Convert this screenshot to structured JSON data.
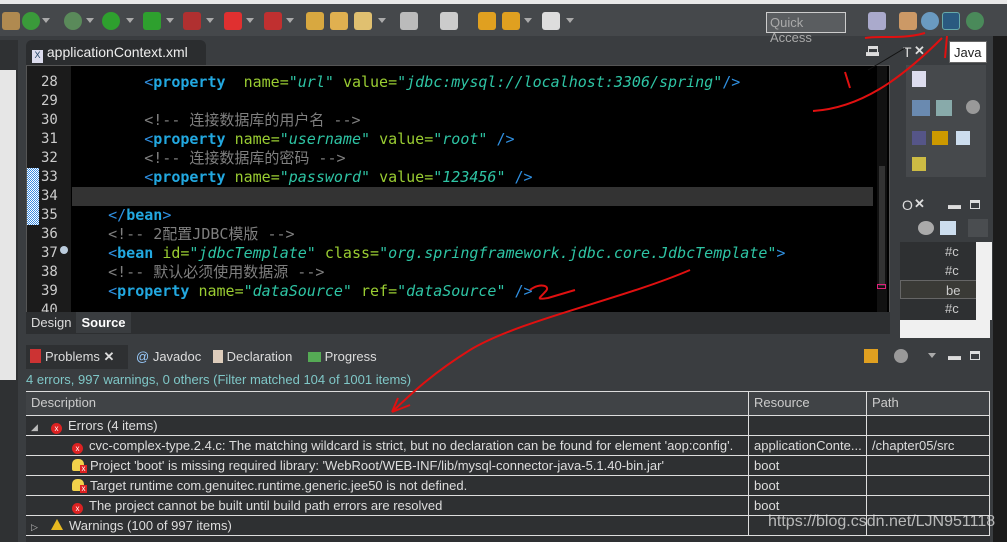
{
  "toolbar": {
    "quick_access": "Quick Access",
    "icons": [
      "new-server-icon",
      "new-class-icon",
      "debug-icon",
      "run-icon",
      "run-server-icon",
      "run-external-icon",
      "stop-icon",
      "disconnect-icon",
      "open-folder-icon",
      "open-type-icon",
      "wand-icon",
      "next-annotation-icon",
      "prev-annotation-icon",
      "back-icon",
      "forward-icon",
      "open-perspective-icon",
      "team-perspective-icon",
      "web-perspective-icon",
      "java-perspective-icon",
      "debug-perspective-icon"
    ]
  },
  "editor": {
    "tab_title": "applicationContext.xml",
    "line_numbers": [
      "28",
      "29",
      "30",
      "31",
      "32",
      "33",
      "34",
      "35",
      "36",
      "37",
      "38",
      "39",
      "40"
    ],
    "lines": {
      "l28": {
        "tag": "property",
        "a1": "name",
        "v1": "\"url\"",
        "a2": "value",
        "v2": "\"jdbc:mysql://localhost:3306/spring\"",
        "end": "/>"
      },
      "l30": "<!-- 连接数据库的用户名 -->",
      "l31": {
        "tag": "property",
        "a1": "name",
        "v1": "\"username\"",
        "a2": "value",
        "v2": "\"root\"",
        "end": "/>"
      },
      "l32": "<!-- 连接数据库的密码 -->",
      "l33": {
        "tag": "property",
        "a1": "name",
        "v1": "\"password\"",
        "a2": "value",
        "v2": "\"123456\"",
        "end": "/>"
      },
      "l35": {
        "tag": "bean"
      },
      "l36": "<!-- 2配置JDBC模版 -->",
      "l37": {
        "tag": "bean",
        "a1": "id",
        "v1": "\"jdbcTemplate\"",
        "a2": "class",
        "v2": "\"org.springframework.jdbc.core.JdbcTemplate\"",
        "end": ">"
      },
      "l38": "<!-- 默认必须使用数据源 -->",
      "l39": {
        "tag": "property",
        "a1": "name",
        "v1": "\"dataSource\"",
        "a2": "ref",
        "v2": "\"dataSource\"",
        "end": "/>"
      }
    },
    "bottom_tabs": [
      "Design",
      "Source"
    ],
    "active_bottom_tab": "Source"
  },
  "right_panels": {
    "type_panel_title": "T",
    "outline_title": "O",
    "java_tooltip": "Java",
    "outline_rows": [
      "#c",
      "#c",
      "be",
      "#c"
    ]
  },
  "problems": {
    "tabs": [
      {
        "label": "Problems"
      },
      {
        "label": "Javadoc"
      },
      {
        "label": "Declaration"
      },
      {
        "label": "Progress"
      }
    ],
    "summary": "4 errors, 997 warnings, 0 others (Filter matched 104 of 1001 items)",
    "columns": [
      "Description",
      "Resource",
      "Path"
    ],
    "errors_group": "Errors (4 items)",
    "rows": [
      {
        "icon": "error",
        "description": "cvc-complex-type.2.4.c: The matching wildcard is strict, but no declaration can be found for element 'aop:config'.",
        "resource": "applicationConte...",
        "path": "/chapter05/src"
      },
      {
        "icon": "library-error",
        "description": "Project 'boot' is missing required library: 'WebRoot/WEB-INF/lib/mysql-connector-java-5.1.40-bin.jar'",
        "resource": "boot",
        "path": ""
      },
      {
        "icon": "library-error",
        "description": "Target runtime com.genuitec.runtime.generic.jee50 is not defined.",
        "resource": "boot",
        "path": ""
      },
      {
        "icon": "error",
        "description": "The project cannot be built until build path errors are resolved",
        "resource": "boot",
        "path": ""
      }
    ],
    "warnings_group": "Warnings (100 of 997 items)"
  },
  "watermark": "https://blog.csdn.net/LJN951118",
  "colors": {
    "tag": "#22a8e0",
    "attr": "#9acd32",
    "value": "#2ec4a4",
    "comment": "#7f7f7f",
    "annotation": "#e01010"
  }
}
